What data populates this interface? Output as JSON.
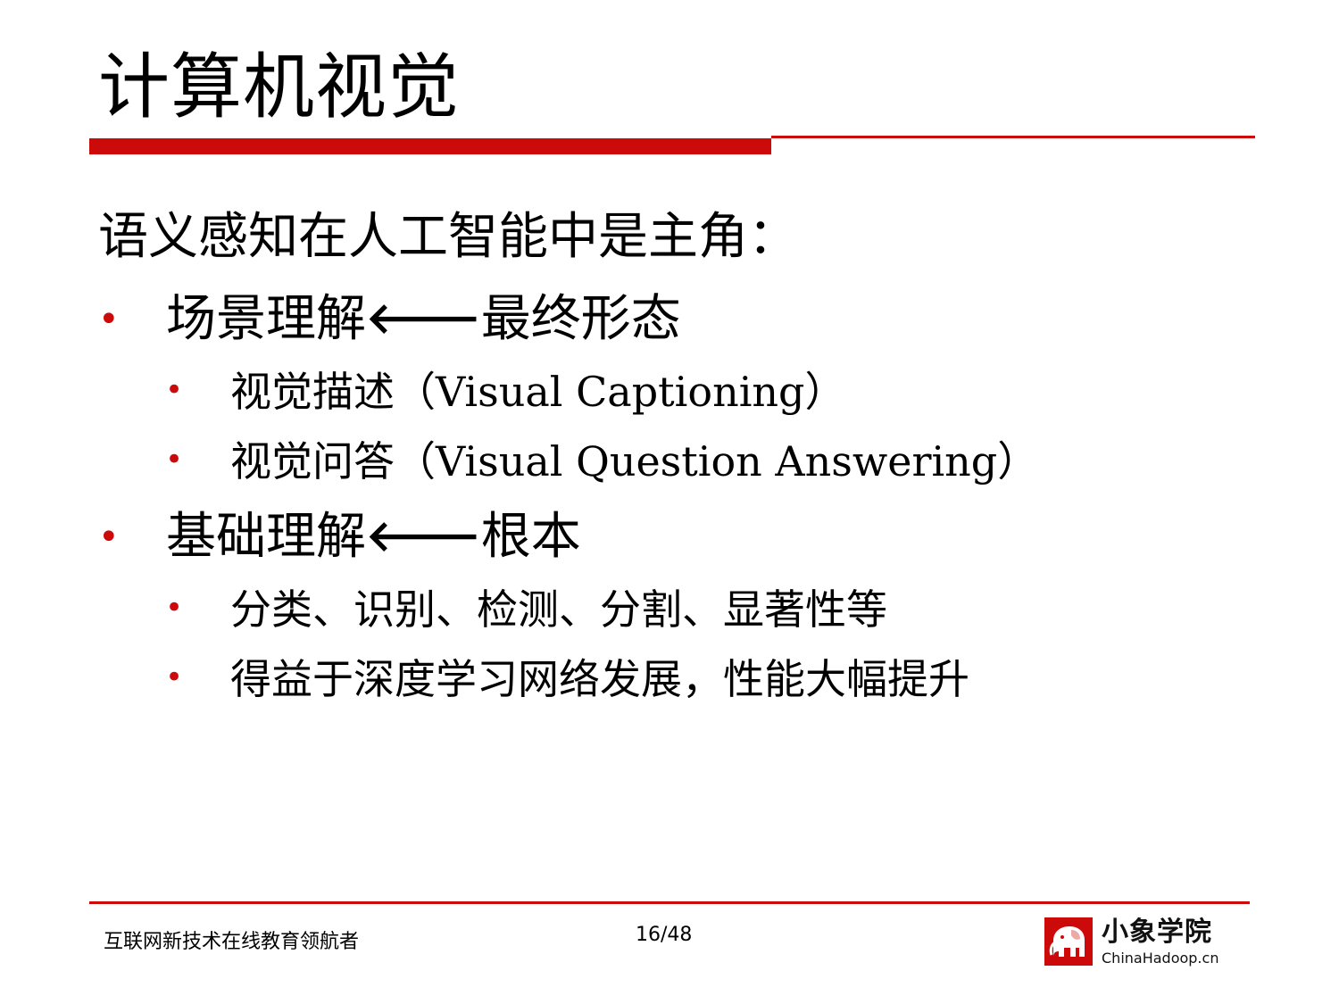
{
  "slide": {
    "title": "计算机视觉",
    "intro": "语义感知在人工智能中是主角："
  },
  "bullets": [
    {
      "before_arrow": "场景理解",
      "arrow": "🡐",
      "after_arrow": "最终形态",
      "children": [
        "视觉描述（Visual Captioning）",
        "视觉问答（Visual Question Answering）"
      ]
    },
    {
      "before_arrow": "基础理解",
      "arrow": "🡐",
      "after_arrow": "根本",
      "children": [
        "分类、识别、检测、分割、显著性等",
        "得益于深度学习网络发展，性能大幅提升"
      ]
    }
  ],
  "bullet_symbol": "•",
  "footer": {
    "tagline": "互联网新技术在线教育领航者",
    "page": "16/48",
    "logo_name": "小象学院",
    "logo_url": "ChinaHadoop.cn"
  },
  "colors": {
    "accent": "#cc0a0a",
    "text": "#000000"
  },
  "icons": {
    "arrow": "left-arrow-icon",
    "logo": "elephant-logo-icon"
  }
}
